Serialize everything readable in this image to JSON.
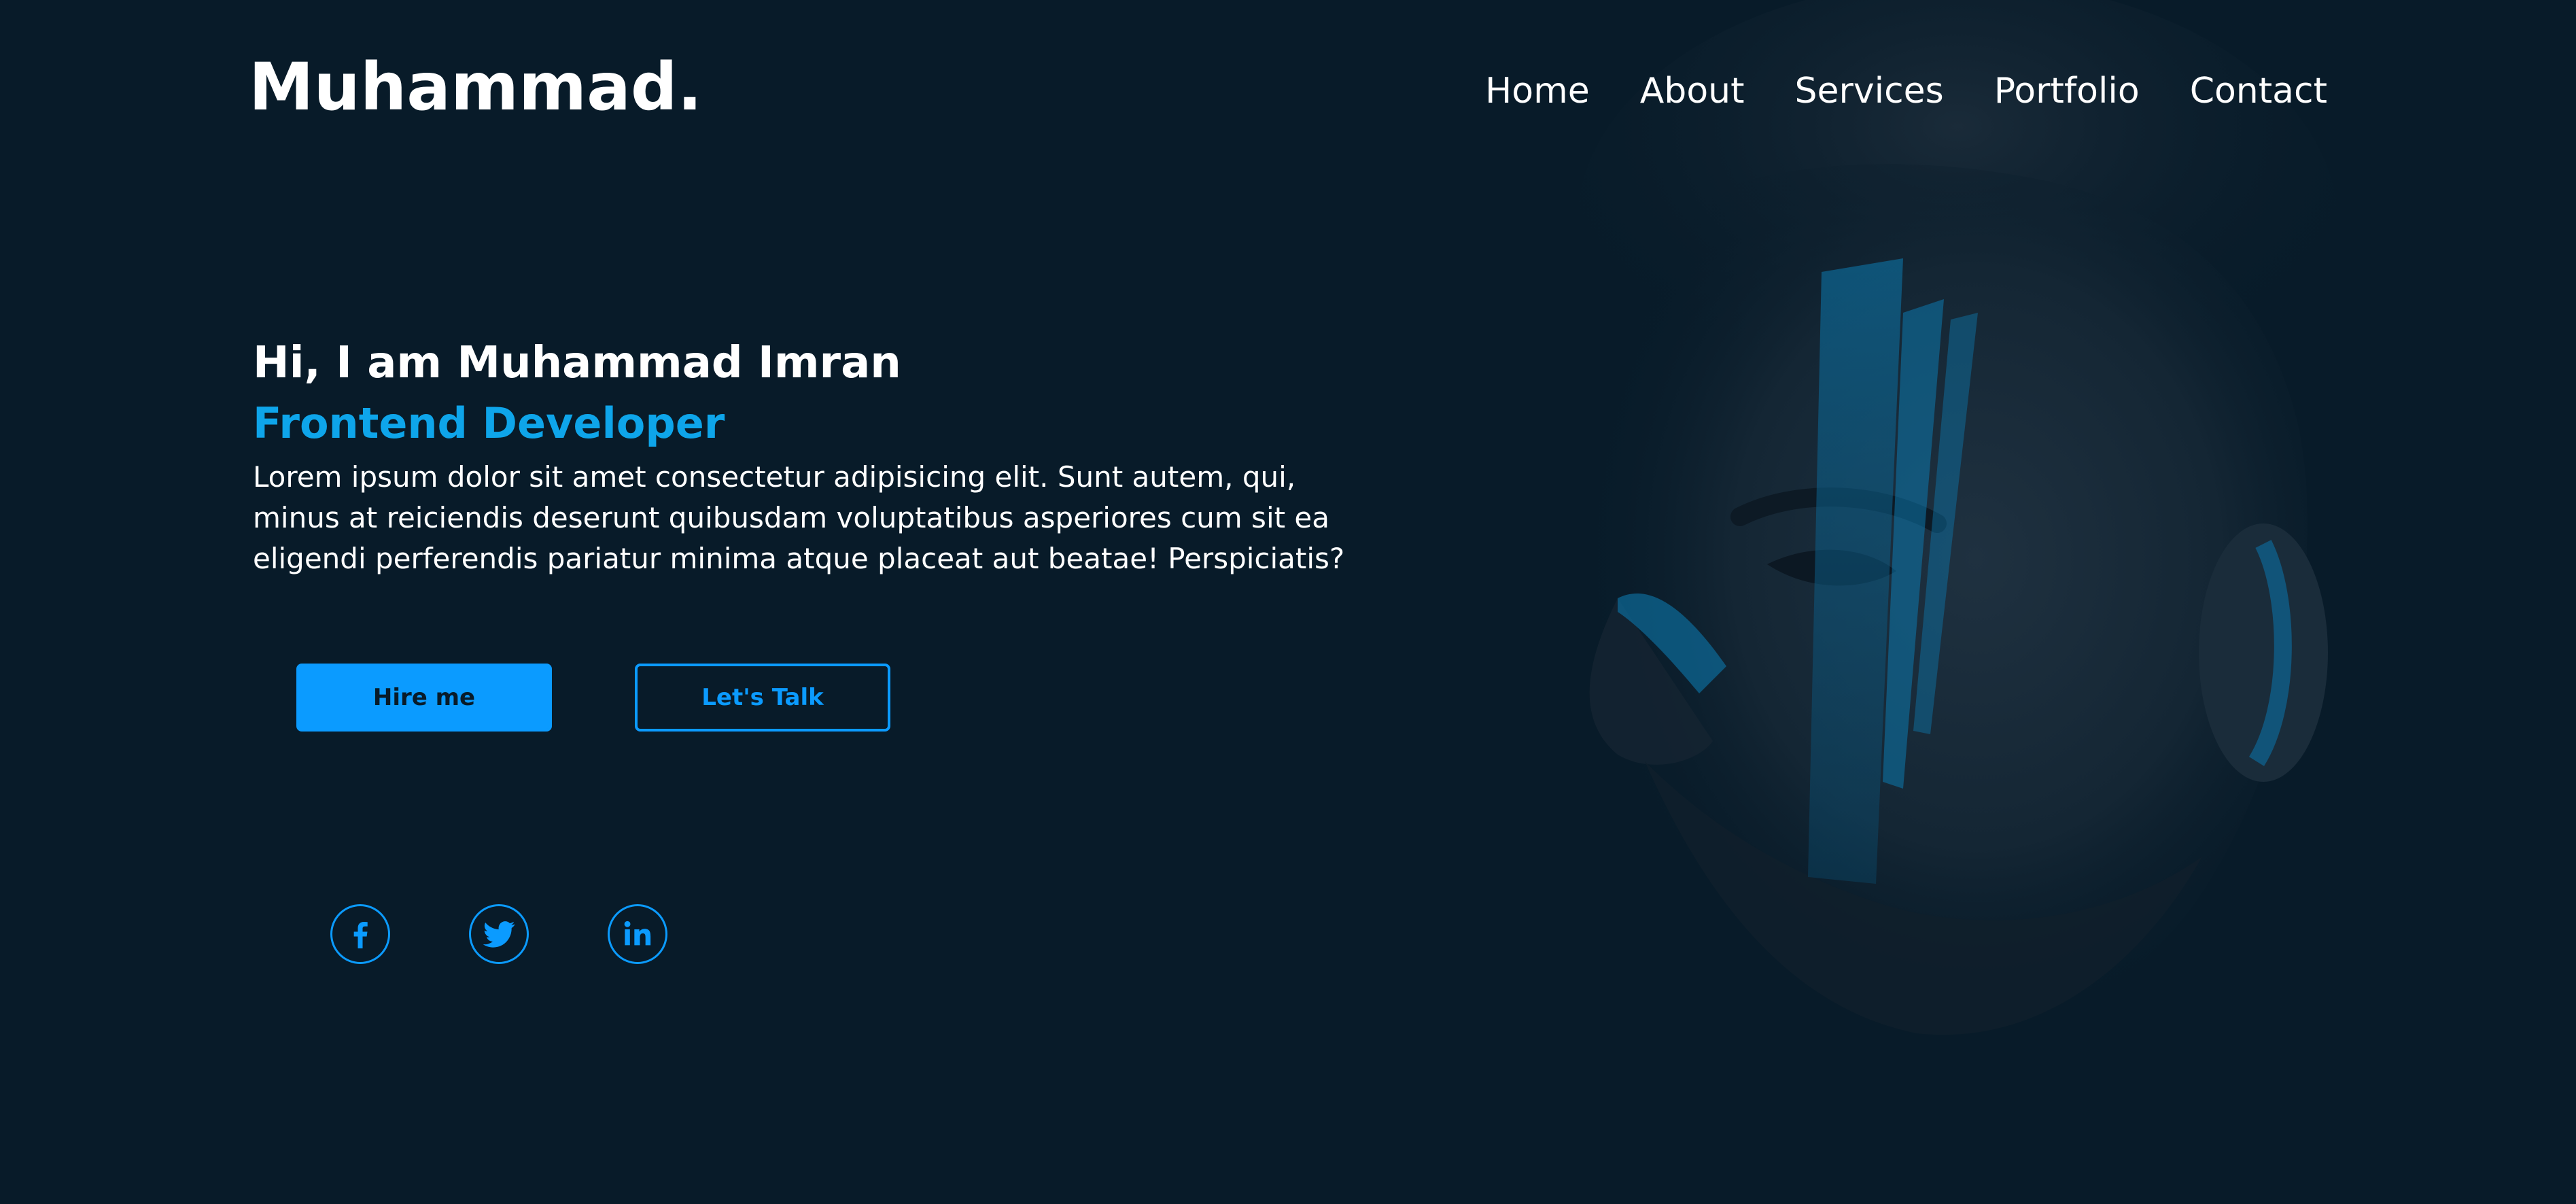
{
  "header": {
    "logo": "Muhammad.",
    "nav": [
      "Home",
      "About",
      "Services",
      "Portfolio",
      "Contact"
    ]
  },
  "hero": {
    "greeting": "Hi, I am Muhammad Imran",
    "role": "Frontend Developer",
    "bio": "Lorem ipsum dolor sit amet consectetur adipisicing elit. Sunt autem, qui, minus at reiciendis deserunt quibusdam voluptatibus asperiores cum sit ea eligendi perferendis pariatur minima atque placeat aut beatae! Perspiciatis?",
    "primary_button": "Hire me",
    "secondary_button": "Let's Talk"
  },
  "socials": [
    {
      "icon": "facebook-icon"
    },
    {
      "icon": "twitter-icon"
    },
    {
      "icon": "linkedin-icon"
    }
  ],
  "colors": {
    "background": "#081b29",
    "accent": "#0b9bff",
    "role_text": "#0ea5ea",
    "text": "#ffffff"
  },
  "images": {
    "hero_portrait": "man-with-blue-face-paint"
  }
}
